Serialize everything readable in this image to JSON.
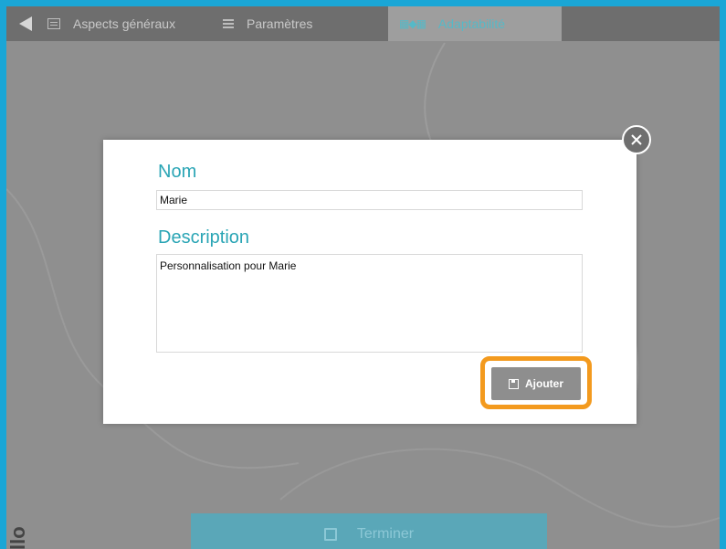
{
  "topbar": {
    "tabs": [
      {
        "label": "Aspects généraux",
        "icon": "grid-icon"
      },
      {
        "label": "Paramètres",
        "icon": "list-icon"
      },
      {
        "label": "Adaptabilité",
        "icon": "adaptability-icon",
        "active": true
      }
    ]
  },
  "modal": {
    "name_label": "Nom",
    "name_value": "Marie",
    "description_label": "Description",
    "description_value": "Personnalisation pour Marie",
    "add_button_label": "Ajouter"
  },
  "footer": {
    "finish_label": "Terminer",
    "side_text": "llo"
  },
  "colors": {
    "border": "#1aa6d6",
    "accent": "#2aa5b5",
    "highlight": "#f39a1e"
  }
}
